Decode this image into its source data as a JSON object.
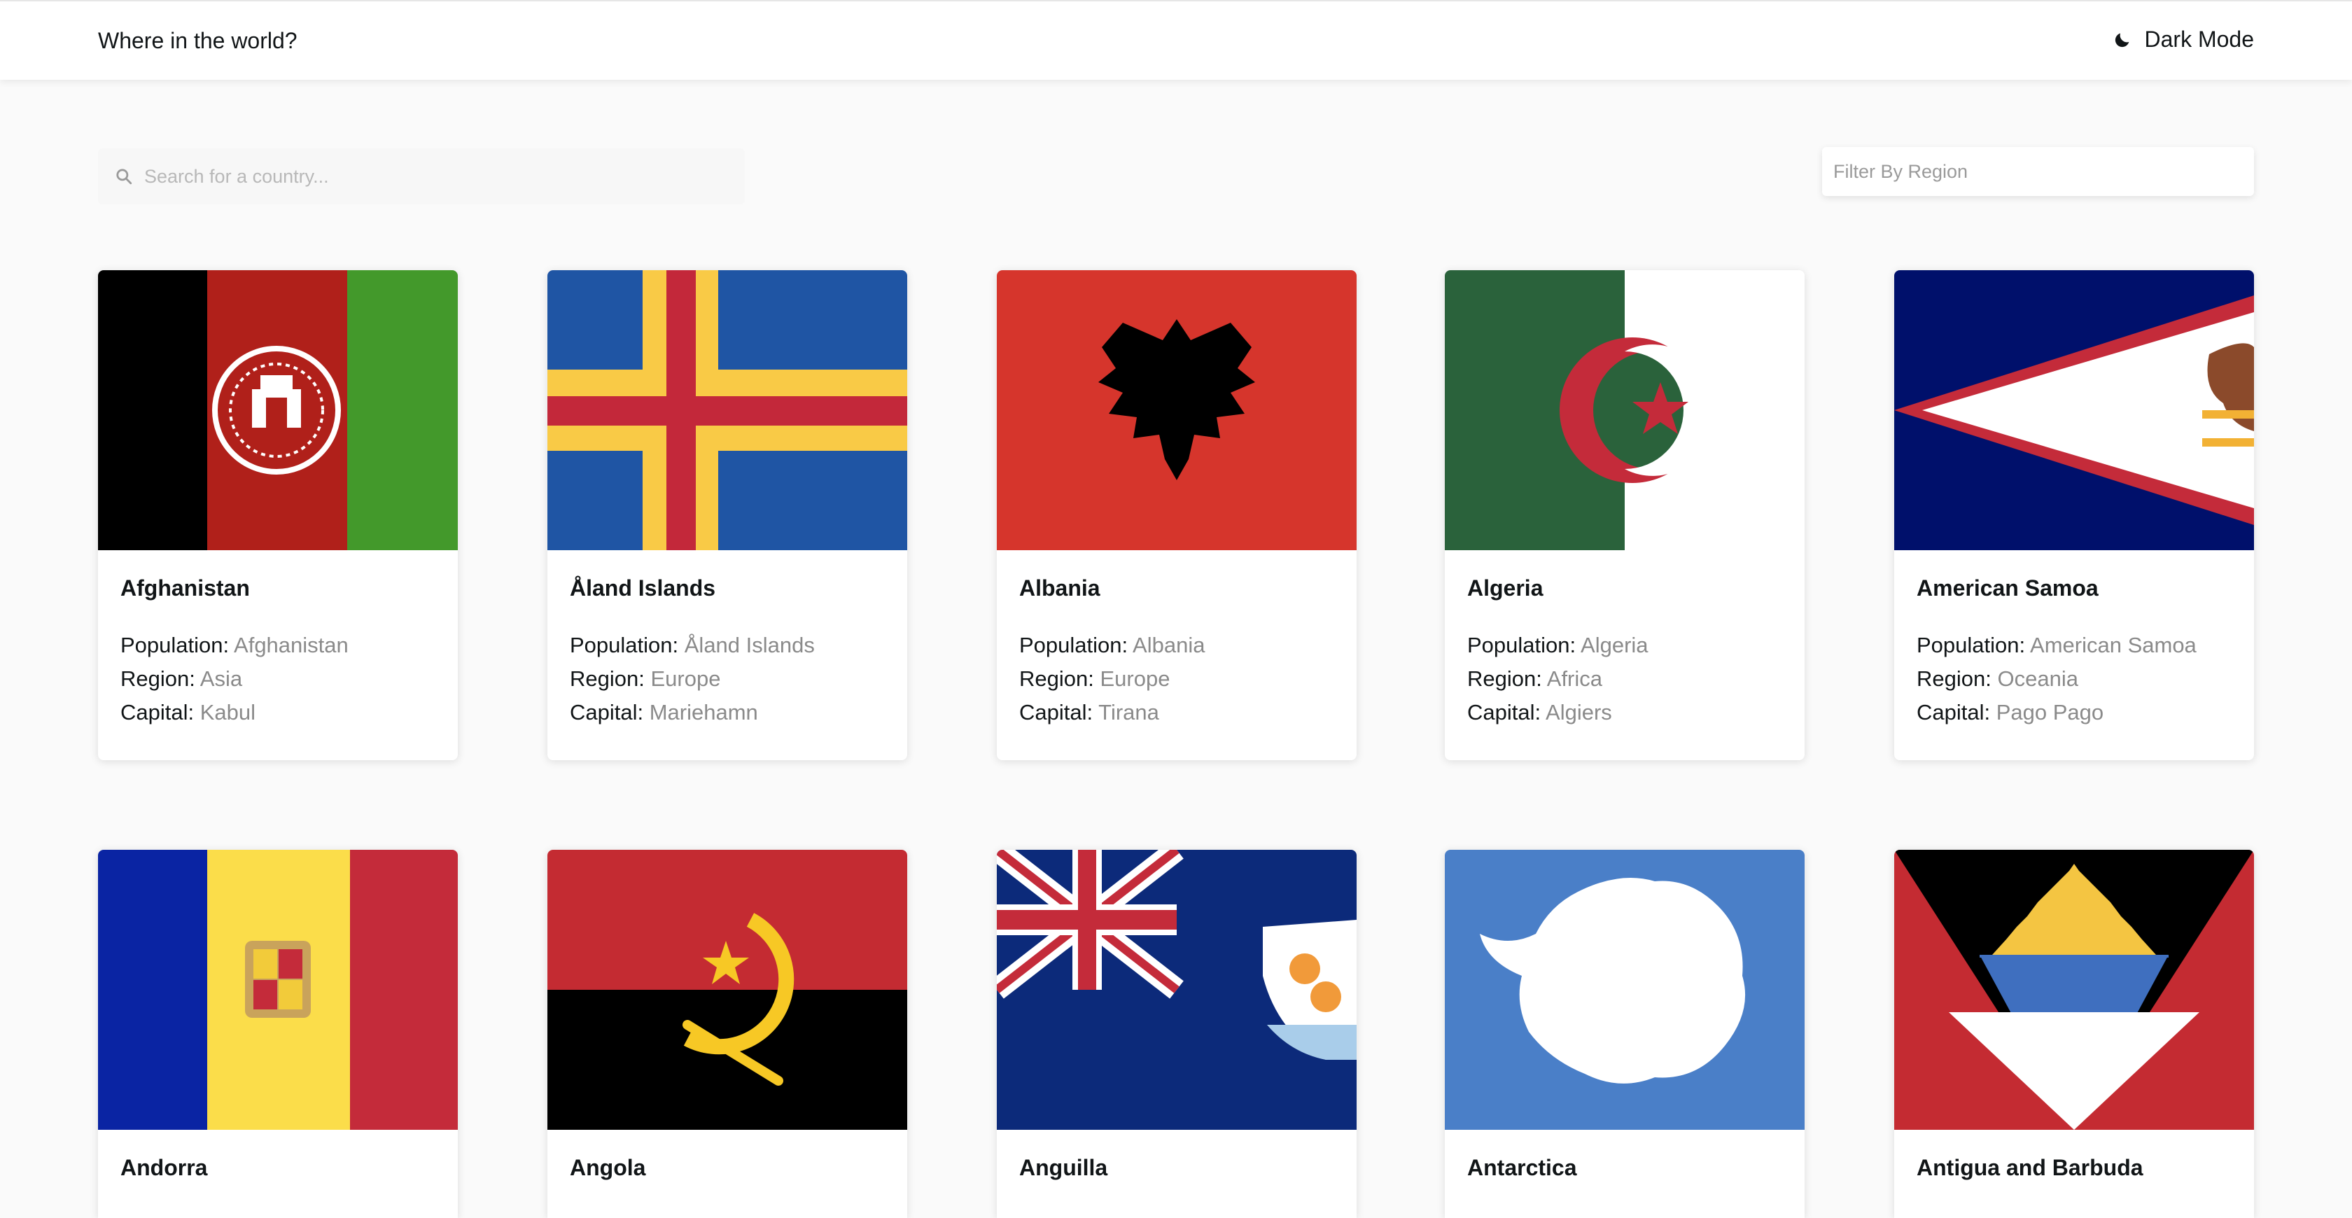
{
  "header": {
    "title": "Where in the world?",
    "mode_label": "Dark Mode"
  },
  "search": {
    "placeholder": "Search for a country..."
  },
  "filter": {
    "label": "Filter By Region"
  },
  "labels": {
    "population": "Population:",
    "region": "Region:",
    "capital": "Capital:"
  },
  "countries": [
    {
      "name": "Afghanistan",
      "population": "Afghanistan",
      "region": "Asia",
      "capital": "Kabul",
      "flag": "afghanistan-flag"
    },
    {
      "name": "Åland Islands",
      "population": "Åland Islands",
      "region": "Europe",
      "capital": "Mariehamn",
      "flag": "aland-flag"
    },
    {
      "name": "Albania",
      "population": "Albania",
      "region": "Europe",
      "capital": "Tirana",
      "flag": "albania-flag"
    },
    {
      "name": "Algeria",
      "population": "Algeria",
      "region": "Africa",
      "capital": "Algiers",
      "flag": "algeria-flag"
    },
    {
      "name": "American Samoa",
      "population": "American Samoa",
      "region": "Oceania",
      "capital": "Pago Pago",
      "flag": "american-samoa-flag"
    },
    {
      "name": "Andorra",
      "flag": "andorra-flag"
    },
    {
      "name": "Angola",
      "flag": "angola-flag"
    },
    {
      "name": "Anguilla",
      "flag": "anguilla-flag"
    },
    {
      "name": "Antarctica",
      "flag": "antarctica-flag"
    },
    {
      "name": "Antigua and Barbuda",
      "flag": "antigua-barbuda-flag"
    }
  ],
  "colors": {
    "background": "#fafafa",
    "card": "#ffffff",
    "text": "#111517",
    "muted": "#8a8a8a"
  }
}
